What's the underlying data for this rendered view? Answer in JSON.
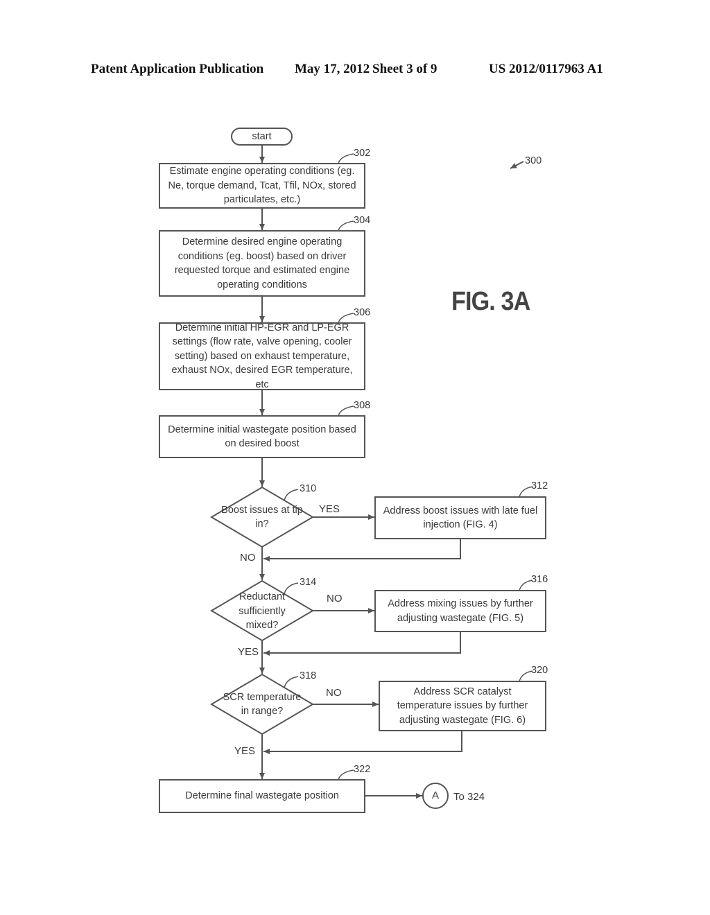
{
  "header": {
    "publication": "Patent Application Publication",
    "date": "May 17, 2012",
    "sheet": "Sheet 3 of 9",
    "number": "US 2012/0117963 A1"
  },
  "figure": {
    "label": "FIG. 3A",
    "reference": "300"
  },
  "start": {
    "label": "start"
  },
  "steps": {
    "s302": {
      "ref": "302",
      "text": "Estimate engine operating conditions (eg. Ne, torque demand, Tcat, Tfil, NOx, stored particulates, etc.)"
    },
    "s304": {
      "ref": "304",
      "text": "Determine desired engine operating conditions (eg. boost) based on driver requested torque and estimated engine operating conditions"
    },
    "s306": {
      "ref": "306",
      "text": "Determine initial HP-EGR and LP-EGR settings (flow rate, valve opening, cooler setting) based on  exhaust temperature, exhaust NOx, desired EGR temperature, etc"
    },
    "s308": {
      "ref": "308",
      "text": "Determine initial wastegate position based on desired boost"
    },
    "s312": {
      "ref": "312",
      "text": "Address boost issues with late fuel injection (FIG. 4)"
    },
    "s316": {
      "ref": "316",
      "text": "Address mixing issues by further adjusting wastegate (FIG. 5)"
    },
    "s320": {
      "ref": "320",
      "text": "Address SCR catalyst temperature issues by further adjusting wastegate (FIG. 6)"
    },
    "s322": {
      "ref": "322",
      "text": "Determine final wastegate position"
    }
  },
  "decisions": {
    "d310": {
      "ref": "310",
      "text": "Boost issues at tip in?",
      "branch_label": "YES",
      "continue_label": "NO"
    },
    "d314": {
      "ref": "314",
      "text": "Reductant sufficiently mixed?",
      "branch_label": "NO",
      "continue_label": "YES"
    },
    "d318": {
      "ref": "318",
      "text": "SCR temperature in range?",
      "branch_label": "NO",
      "continue_label": "YES"
    }
  },
  "connector": {
    "label": "A",
    "target": "To 324"
  }
}
